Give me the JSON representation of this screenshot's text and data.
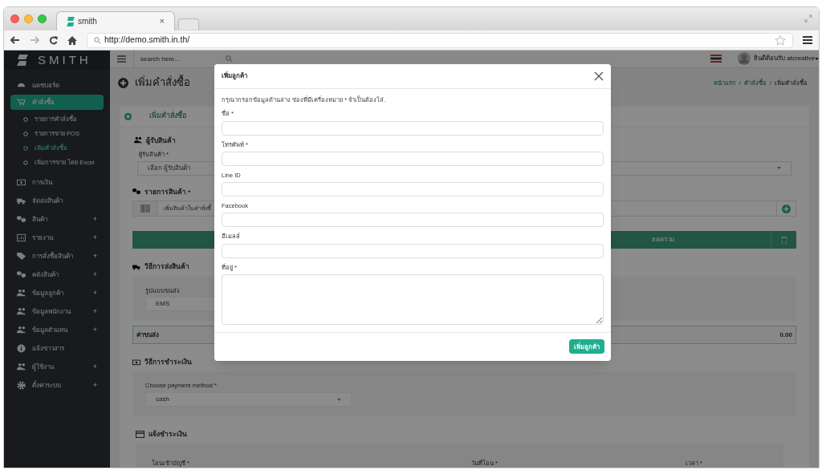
{
  "browser": {
    "tab_title": "smith",
    "tab_close": "×",
    "url": "http://demo.smith.in.th/"
  },
  "sidebar": {
    "logo": "SMITH",
    "items": [
      {
        "label": "แดชบอร์ด",
        "kind": "gauge",
        "selected": false
      },
      {
        "label": "คำสั่งซื้อ",
        "kind": "cart",
        "selected": true,
        "children": [
          {
            "label": "รายการคำสั่งซื้อ",
            "selected": false
          },
          {
            "label": "รายการขาย POS",
            "selected": false
          },
          {
            "label": "เพิ่มคำสั่งซื้อ",
            "selected": true
          },
          {
            "label": "เพิ่มการขาย โดย Excel",
            "selected": false
          }
        ]
      },
      {
        "label": "การเงิน",
        "kind": "money",
        "selected": false
      },
      {
        "label": "จัดส่งสินค้า",
        "kind": "truck",
        "selected": false
      },
      {
        "label": "สินค้า",
        "kind": "cubes",
        "toggle": "+",
        "selected": false
      },
      {
        "label": "รายงาน",
        "kind": "chart",
        "toggle": "+",
        "selected": false
      },
      {
        "label": "การสั่งซื้อสินค้า",
        "kind": "tag",
        "toggle": "+",
        "selected": false
      },
      {
        "label": "คลังสินค้า",
        "kind": "cubes",
        "toggle": "+",
        "selected": false
      },
      {
        "label": "ข้อมูลลูกค้า",
        "kind": "users",
        "toggle": "+",
        "selected": false
      },
      {
        "label": "ข้อมูลพนักงาน",
        "kind": "users",
        "toggle": "+",
        "selected": false
      },
      {
        "label": "ข้อมูลตัวแทน",
        "kind": "users",
        "toggle": "+",
        "selected": false
      },
      {
        "label": "แจ้งข่าวสาร",
        "kind": "info",
        "selected": false
      },
      {
        "label": "ผู้ใช้งาน",
        "kind": "users",
        "toggle": "+",
        "selected": false
      },
      {
        "label": "ตั้งค่าระบบ",
        "kind": "gear",
        "toggle": "+",
        "selected": false
      }
    ]
  },
  "topbar": {
    "search_placeholder": "search here...",
    "user": "ยินดีต้อนรับ atcreative"
  },
  "page": {
    "title": "เพิ่มคำสั่งซื้อ",
    "breadcrumb_separator": "/",
    "breadcrumb": [
      {
        "label": "หน้าแรก",
        "current": false
      },
      {
        "label": "คำสั่งซื้อ",
        "current": false
      },
      {
        "label": "เพิ่มคำสั่งซื้อ",
        "current": true
      }
    ],
    "panel_title": "เพิ่มคำสั่งซื้อ",
    "recipient": {
      "heading": "ผู้รับสินค้า",
      "label": "ผู้รับสินค้า *",
      "placeholder": "เลือก ผู้รับสินค้า"
    },
    "items": {
      "heading": "รายการสินค้า •",
      "placeholder": "เพิ่มสินค้าในคำสั่งซื้",
      "total_label": "ยอดรวม"
    },
    "shipping": {
      "heading": "วิธีการส่งสินค้า",
      "label": "รูปแบบขนส่ง",
      "value": "EMS",
      "fee_label": "ค่าขนส่ง",
      "fee": "0.00"
    },
    "payment": {
      "heading": "วิธีการชำระเงิน",
      "label": "Choose payment method *",
      "value": "cash"
    },
    "notify": {
      "heading": "แจ้งชำระเงิน",
      "columns": [
        "โอนเข้าบัญชี *",
        "วันที่โอน *",
        "เวลา *"
      ]
    }
  },
  "modal": {
    "title": "เพิ่มลูกค้า",
    "intro": "กรุณากรอกข้อมูลด้านล่าง ช่องที่มีเครื่องหมาย * จำเป็นต้องใส่.",
    "fields": [
      {
        "label": "ชื่อ *",
        "kind": "input"
      },
      {
        "label": "โทรศัพท์ *",
        "kind": "input"
      },
      {
        "label": "Line ID",
        "kind": "input"
      },
      {
        "label": "Facebook",
        "kind": "input"
      },
      {
        "label": "อีเมลล์",
        "kind": "input"
      },
      {
        "label": "ที่อยู่ *",
        "kind": "textarea"
      }
    ],
    "submit": "เพิ่มลูกค้า"
  }
}
